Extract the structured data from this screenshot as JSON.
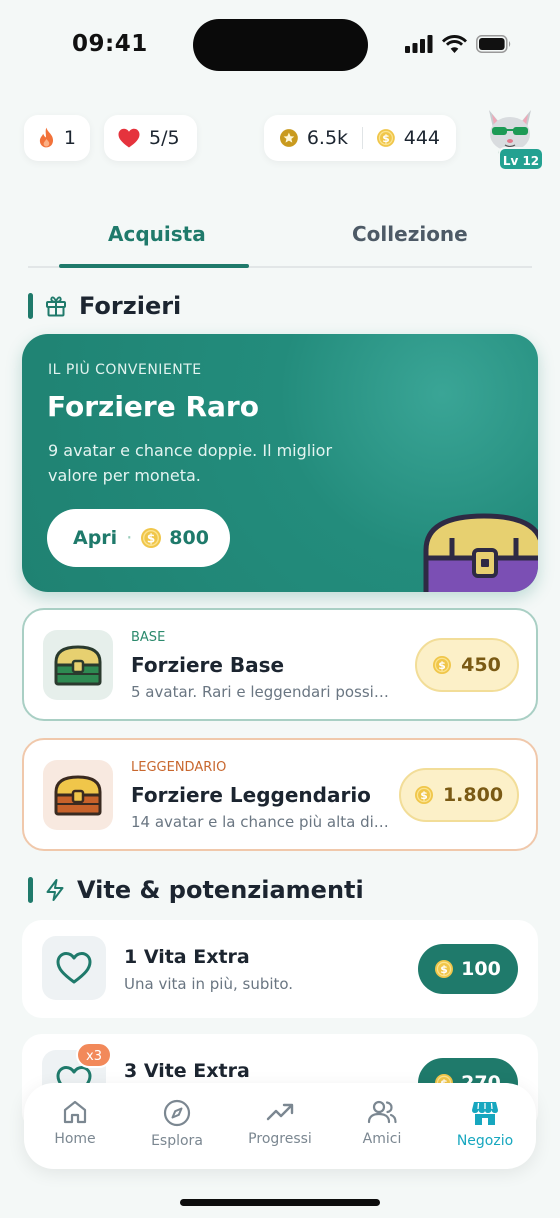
{
  "status_bar": {
    "time": "09:41"
  },
  "stats": {
    "streak": "1",
    "lives": "5/5",
    "xp": "6.5k",
    "coins": "444"
  },
  "profile": {
    "level": "Lv 12"
  },
  "tabs": [
    {
      "label": "Acquista",
      "active": true
    },
    {
      "label": "Collezione",
      "active": false
    }
  ],
  "chests_section": {
    "title": "Forzieri"
  },
  "featured_chest": {
    "kicker": "IL PIÙ CONVENIENTE",
    "title": "Forziere Raro",
    "description": "9 avatar e chance doppie. Il miglior valore per moneta.",
    "button_label": "Apri",
    "button_separator": "·",
    "price": "800"
  },
  "chests": [
    {
      "tier": "BASE",
      "name": "Forziere Base",
      "description": "5 avatar. Rari e leggendari possi…",
      "price": "450",
      "accent": "#2c8a6d"
    },
    {
      "tier": "LEGGENDARIO",
      "name": "Forziere Leggendario",
      "description": "14 avatar e la chance più alta di…",
      "price": "1.800",
      "accent": "#c8672e"
    }
  ],
  "boosts_section": {
    "title": "Vite & potenziamenti"
  },
  "boosts": [
    {
      "name": "1 Vita Extra",
      "description": "Una vita in più, subito.",
      "price": "100"
    },
    {
      "name": "3 Vite Extra",
      "badge": "x3",
      "price": "270"
    }
  ],
  "nav": [
    {
      "label": "Home",
      "icon": "home-icon"
    },
    {
      "label": "Esplora",
      "icon": "compass-icon"
    },
    {
      "label": "Progressi",
      "icon": "trending-icon"
    },
    {
      "label": "Amici",
      "icon": "users-icon"
    },
    {
      "label": "Negozio",
      "icon": "shop-icon",
      "active": true
    }
  ],
  "colors": {
    "primary": "#1f7a6b",
    "accent_nav": "#17a7bf",
    "coin": "#f0c64a",
    "heart": "#e5333d"
  }
}
